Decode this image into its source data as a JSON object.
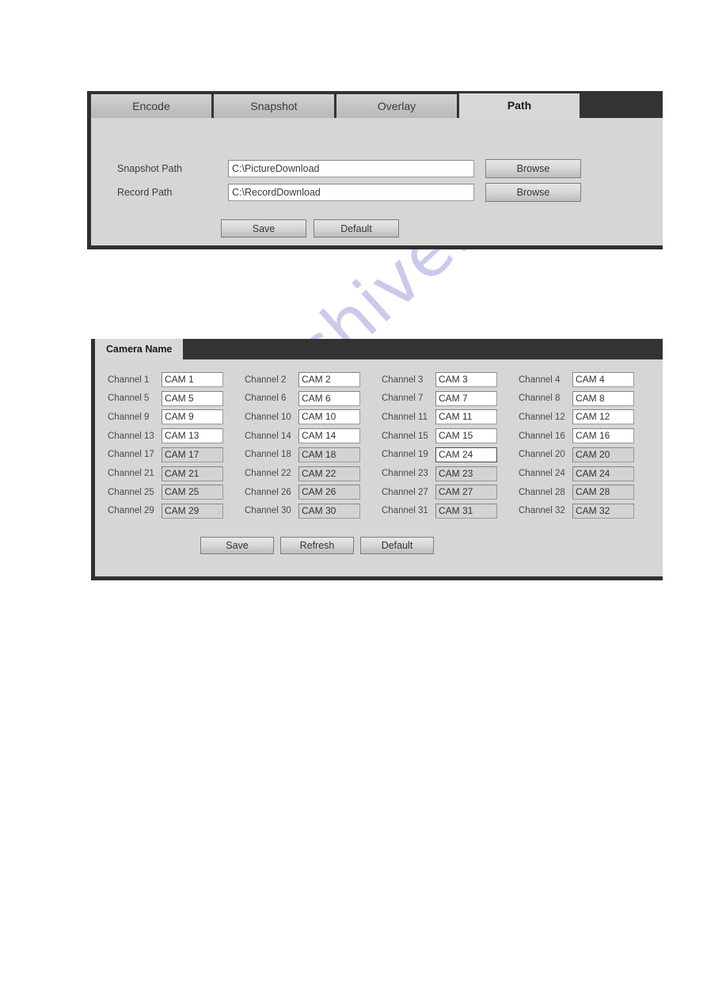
{
  "watermark": {
    "text": "manualshive.com",
    "color": "#c9c8ec"
  },
  "path_panel": {
    "tabs": [
      {
        "label": "Encode",
        "active": false
      },
      {
        "label": "Snapshot",
        "active": false
      },
      {
        "label": "Overlay",
        "active": false
      },
      {
        "label": "Path",
        "active": true
      }
    ],
    "fields": [
      {
        "label": "Snapshot Path",
        "value": "C:\\PictureDownload",
        "button": "Browse"
      },
      {
        "label": "Record Path",
        "value": "C:\\RecordDownload",
        "button": "Browse"
      }
    ],
    "buttons": [
      {
        "label": "Save"
      },
      {
        "label": "Default"
      }
    ]
  },
  "camera_panel": {
    "tabs": [
      {
        "label": "Camera Name",
        "active": true
      }
    ],
    "channels": [
      {
        "label": "Channel 1",
        "value": "CAM 1",
        "dim": false,
        "focused": false
      },
      {
        "label": "Channel 2",
        "value": "CAM 2",
        "dim": false,
        "focused": false
      },
      {
        "label": "Channel 3",
        "value": "CAM 3",
        "dim": false,
        "focused": false
      },
      {
        "label": "Channel 4",
        "value": "CAM 4",
        "dim": false,
        "focused": false
      },
      {
        "label": "Channel 5",
        "value": "CAM 5",
        "dim": false,
        "focused": false
      },
      {
        "label": "Channel 6",
        "value": "CAM 6",
        "dim": false,
        "focused": false
      },
      {
        "label": "Channel 7",
        "value": "CAM 7",
        "dim": false,
        "focused": false
      },
      {
        "label": "Channel 8",
        "value": "CAM 8",
        "dim": false,
        "focused": false
      },
      {
        "label": "Channel 9",
        "value": "CAM 9",
        "dim": false,
        "focused": false
      },
      {
        "label": "Channel 10",
        "value": "CAM 10",
        "dim": false,
        "focused": false
      },
      {
        "label": "Channel 11",
        "value": "CAM 11",
        "dim": false,
        "focused": false
      },
      {
        "label": "Channel 12",
        "value": "CAM 12",
        "dim": false,
        "focused": false
      },
      {
        "label": "Channel 13",
        "value": "CAM 13",
        "dim": false,
        "focused": false
      },
      {
        "label": "Channel 14",
        "value": "CAM 14",
        "dim": false,
        "focused": false
      },
      {
        "label": "Channel 15",
        "value": "CAM 15",
        "dim": false,
        "focused": false
      },
      {
        "label": "Channel 16",
        "value": "CAM 16",
        "dim": false,
        "focused": false
      },
      {
        "label": "Channel 17",
        "value": "CAM 17",
        "dim": true,
        "focused": false
      },
      {
        "label": "Channel 18",
        "value": "CAM 18",
        "dim": true,
        "focused": false
      },
      {
        "label": "Channel 19",
        "value": "CAM 24",
        "dim": false,
        "focused": true
      },
      {
        "label": "Channel 20",
        "value": "CAM 20",
        "dim": true,
        "focused": false
      },
      {
        "label": "Channel 21",
        "value": "CAM 21",
        "dim": true,
        "focused": false
      },
      {
        "label": "Channel 22",
        "value": "CAM 22",
        "dim": true,
        "focused": false
      },
      {
        "label": "Channel 23",
        "value": "CAM 23",
        "dim": true,
        "focused": false
      },
      {
        "label": "Channel 24",
        "value": "CAM 24",
        "dim": true,
        "focused": false
      },
      {
        "label": "Channel 25",
        "value": "CAM 25",
        "dim": true,
        "focused": false
      },
      {
        "label": "Channel 26",
        "value": "CAM 26",
        "dim": true,
        "focused": false
      },
      {
        "label": "Channel 27",
        "value": "CAM 27",
        "dim": true,
        "focused": false
      },
      {
        "label": "Channel 28",
        "value": "CAM 28",
        "dim": true,
        "focused": false
      },
      {
        "label": "Channel 29",
        "value": "CAM 29",
        "dim": true,
        "focused": false
      },
      {
        "label": "Channel 30",
        "value": "CAM 30",
        "dim": true,
        "focused": false
      },
      {
        "label": "Channel 31",
        "value": "CAM 31",
        "dim": true,
        "focused": false
      },
      {
        "label": "Channel 32",
        "value": "CAM 32",
        "dim": true,
        "focused": false
      }
    ],
    "buttons": [
      {
        "label": "Save"
      },
      {
        "label": "Refresh"
      },
      {
        "label": "Default"
      }
    ]
  }
}
